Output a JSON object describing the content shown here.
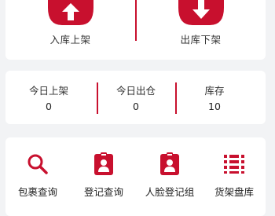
{
  "theme": {
    "accent": "#c8102e",
    "card_bg": "#ffffff",
    "page_bg": "#f2f3f5"
  },
  "actions": [
    {
      "label": "入库上架",
      "icon": "cloud-upload-icon"
    },
    {
      "label": "出库下架",
      "icon": "cloud-download-icon"
    }
  ],
  "stats": [
    {
      "label": "今日上架",
      "value": "0"
    },
    {
      "label": "今日出仓",
      "value": "0"
    },
    {
      "label": "库存",
      "value": "10"
    }
  ],
  "tools": [
    {
      "label": "包裹查询",
      "icon": "search-icon"
    },
    {
      "label": "登记查询",
      "icon": "id-badge-icon"
    },
    {
      "label": "人脸登记组",
      "icon": "face-badge-icon"
    },
    {
      "label": "货架盘库",
      "icon": "shelf-inventory-icon"
    }
  ]
}
